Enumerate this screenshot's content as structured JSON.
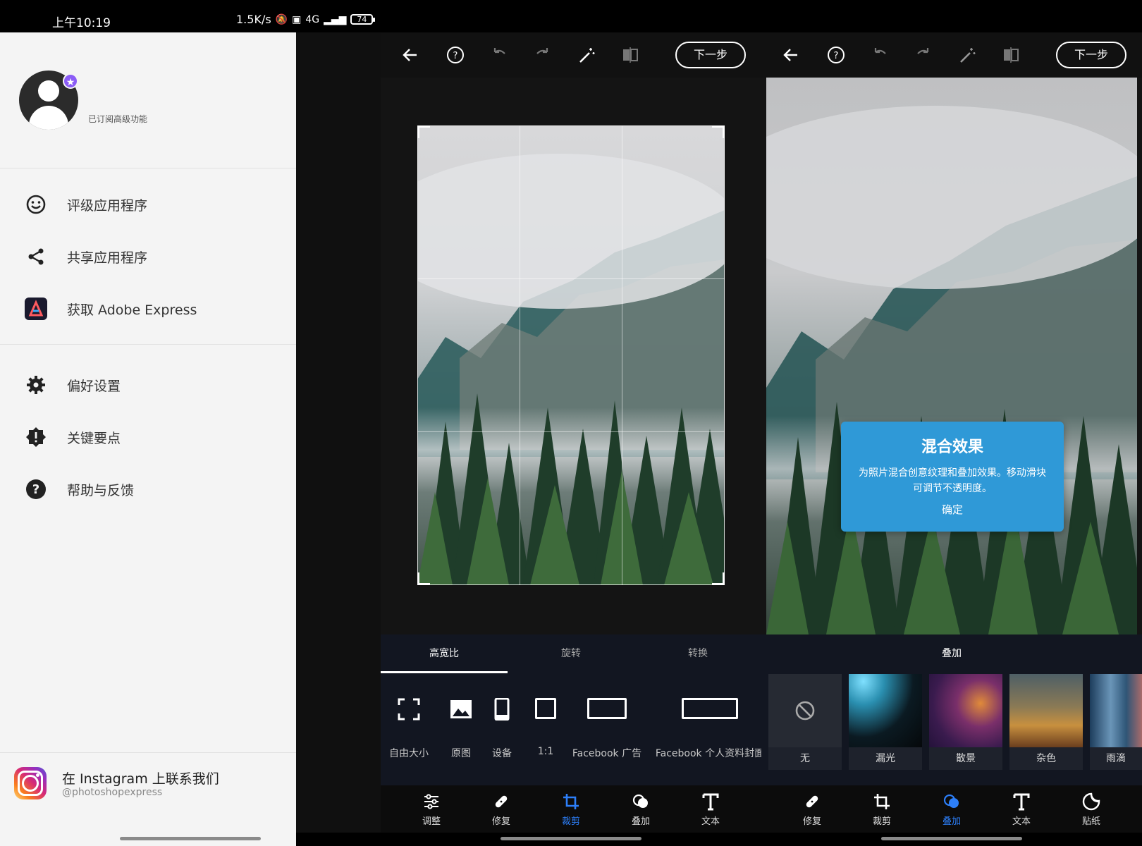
{
  "status": {
    "time": "上午10:19",
    "speed": "1.5K/s",
    "network": "4G",
    "battery": "74"
  },
  "drawer": {
    "subscription": "已订阅高级功能",
    "menu": [
      {
        "label": "评级应用程序",
        "icon": "smile-icon"
      },
      {
        "label": "共享应用程序",
        "icon": "share-icon"
      },
      {
        "label": "获取 Adobe Express",
        "icon": "adobe-express-icon"
      },
      {
        "label": "偏好设置",
        "icon": "gear-icon"
      },
      {
        "label": "关键要点",
        "icon": "alert-badge-icon"
      },
      {
        "label": "帮助与反馈",
        "icon": "help-icon"
      }
    ],
    "instagram": {
      "title": "在 Instagram 上联系我们",
      "handle": "@photoshopexpress"
    }
  },
  "editor": {
    "next_label": "下一步",
    "crop_tabs": [
      "高宽比",
      "旋转",
      "转换"
    ],
    "aspects": [
      "自由大小",
      "原图",
      "设备",
      "1:1",
      "Facebook 广告",
      "Facebook 个人资料封面"
    ],
    "nav_crop": [
      {
        "label": "调整",
        "icon": "sliders-icon"
      },
      {
        "label": "修复",
        "icon": "bandage-icon"
      },
      {
        "label": "裁剪",
        "icon": "crop-icon",
        "active": true
      },
      {
        "label": "叠加",
        "icon": "overlay-icon"
      },
      {
        "label": "文本",
        "icon": "text-icon"
      }
    ],
    "overlay_title": "叠加",
    "overlays": [
      "无",
      "漏光",
      "散景",
      "杂色",
      "雨滴"
    ],
    "nav_overlay": [
      {
        "label": "修复",
        "icon": "bandage-icon"
      },
      {
        "label": "裁剪",
        "icon": "crop-icon"
      },
      {
        "label": "叠加",
        "icon": "overlay-icon",
        "active": true
      },
      {
        "label": "文本",
        "icon": "text-icon"
      },
      {
        "label": "贴纸",
        "icon": "sticker-icon"
      }
    ],
    "tooltip": {
      "title": "混合效果",
      "body": "为照片混合创意纹理和叠加效果。移动滑块可调节不透明度。",
      "ok": "确定"
    }
  },
  "colors": {
    "accent": "#2d7ff9",
    "tooltip": "#2f99d7",
    "drawer_bg": "#f4f4f4",
    "editor_bg": "#151515"
  }
}
